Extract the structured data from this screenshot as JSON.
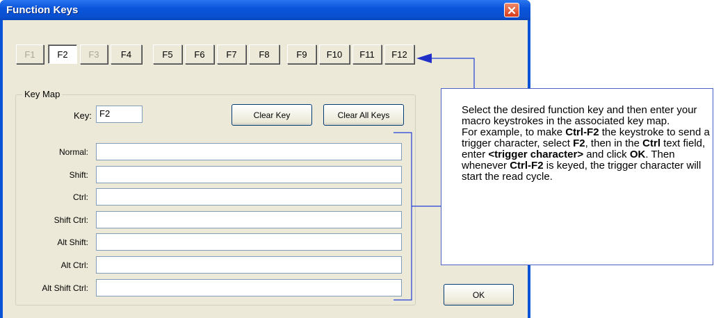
{
  "window": {
    "title": "Function Keys"
  },
  "function_keys": [
    {
      "label": "F1",
      "enabled": false
    },
    {
      "label": "F2",
      "enabled": true,
      "selected": true
    },
    {
      "label": "F3",
      "enabled": false
    },
    {
      "label": "F4",
      "enabled": true
    },
    {
      "label": "F5",
      "enabled": true
    },
    {
      "label": "F6",
      "enabled": true
    },
    {
      "label": "F7",
      "enabled": true
    },
    {
      "label": "F8",
      "enabled": true
    },
    {
      "label": "F9",
      "enabled": true
    },
    {
      "label": "F10",
      "enabled": true
    },
    {
      "label": "F11",
      "enabled": true
    },
    {
      "label": "F12",
      "enabled": true
    }
  ],
  "key_map": {
    "group_label": "Key Map",
    "key_label": "Key:",
    "key_value": "F2",
    "clear_key": "Clear Key",
    "clear_all_keys": "Clear All Keys",
    "rows": [
      {
        "label": "Normal:",
        "value": ""
      },
      {
        "label": "Shift:",
        "value": ""
      },
      {
        "label": "Ctrl:",
        "value": ""
      },
      {
        "label": "Shift Ctrl:",
        "value": ""
      },
      {
        "label": "Alt Shift:",
        "value": ""
      },
      {
        "label": "Alt Ctrl:",
        "value": ""
      },
      {
        "label": "Alt Shift Ctrl:",
        "value": ""
      }
    ]
  },
  "ok_button": "OK",
  "callout": {
    "line1": "Select the desired function key and then enter your macro keystrokes in the associated key map.",
    "p2_a": "For example, to make ",
    "p2_b": "Ctrl-F2",
    "p2_c": " the keystroke to send a trigger character, select ",
    "p2_d": "F2",
    "p2_e": ", then in the ",
    "p2_f": "Ctrl",
    "p2_g": " text field, enter ",
    "p2_h": "<trigger character>",
    "p2_i": " and click ",
    "p2_j": "OK",
    "p2_k": ". Then whenever ",
    "p2_l": "Ctrl-F2",
    "p2_m": " is keyed, the trigger character will start the read cycle."
  },
  "colors": {
    "titlebar": "#0a55dc",
    "dialog_bg": "#ece9d8",
    "callout_line": "#1f3fd6"
  }
}
